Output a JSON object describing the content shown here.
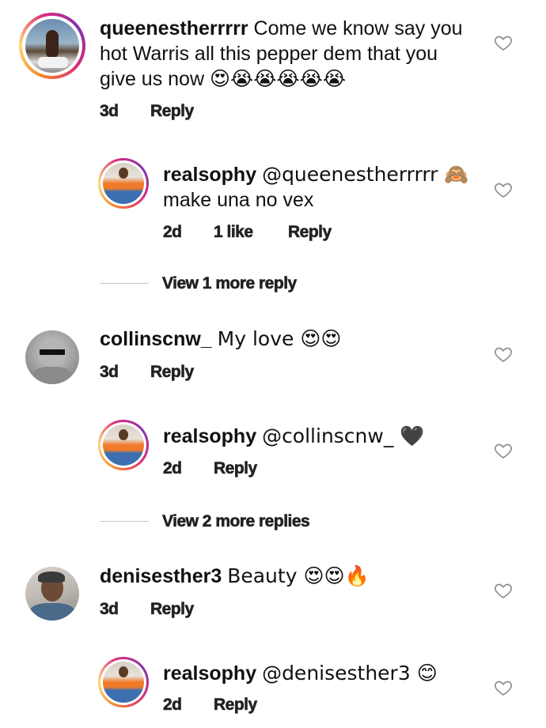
{
  "comments": [
    {
      "username": "queenestherrrrr",
      "text_line1": "Come we know say you",
      "text_line2": "hot Warris all this pepper dem that you",
      "text_line3": "give us now",
      "emojis": "😍😭😭😭😭😭",
      "age": "3d",
      "reply_label": "Reply",
      "reply": {
        "username": "realsophy",
        "text_line1": "@queenestherrrrr 🙈",
        "text_line2": "make una no vex",
        "age": "2d",
        "likes": "1 like",
        "reply_label": "Reply"
      },
      "view_more": "View 1 more reply"
    },
    {
      "username": "collinscnw_",
      "text_line1": "My love 😍😍",
      "age": "3d",
      "reply_label": "Reply",
      "reply": {
        "username": "realsophy",
        "text_line1": "@collinscnw_ 🖤",
        "age": "2d",
        "reply_label": "Reply"
      },
      "view_more": "View 2 more replies"
    },
    {
      "username": "denisesther3",
      "text_line1": "Beauty 😍😍🔥",
      "age": "3d",
      "reply_label": "Reply",
      "reply": {
        "username": "realsophy",
        "text_line1": "@denisesther3 😊",
        "age": "2d",
        "reply_label": "Reply"
      }
    }
  ],
  "colors": {
    "heart_outline": "#8e8e8e",
    "divider": "#c8c8c8"
  },
  "icons": {
    "like": "heart-outline-icon"
  }
}
